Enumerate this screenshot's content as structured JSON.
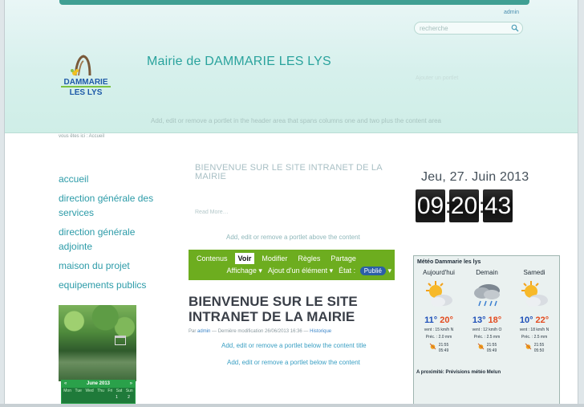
{
  "header": {
    "admin_link": "admin",
    "search_placeholder": "recherche",
    "site_title": "Mairie de DAMMARIE LES LYS",
    "faint_link": "Ajouter un portlet",
    "portlet_message": "Add, edit or remove a portlet in the header area that spans columns one and two plus the content area",
    "logo": {
      "line1": "DAMMARIE",
      "line2": "LES LYS"
    }
  },
  "breadcrumb": "vous êtes ici : Accueil",
  "nav": {
    "items": [
      "accueil",
      "direction générale des services",
      "direction générale adjointe",
      "maison du projet",
      "equipements publics"
    ]
  },
  "mini_calendar": {
    "month": "June 2013",
    "prev": "«",
    "next": "»",
    "days": [
      "Mon",
      "Tue",
      "Wed",
      "Thu",
      "Fri",
      "Sat",
      "Sun"
    ],
    "row": [
      "",
      "",
      "",
      "",
      "",
      "1",
      "2"
    ]
  },
  "content": {
    "welcome_faint": "BIENVENUE SUR LE SITE INTRANET DE LA MAIRIE",
    "read_more": "Read More…",
    "portlet_above": "Add, edit or remove a portlet above the content",
    "editbar": {
      "tabs": [
        "Contenus",
        "Voir",
        "Modifier",
        "Règles",
        "Partage"
      ],
      "active_tab": 1,
      "display_menu": "Affichage ▾",
      "add_menu": "Ajout d'un élément ▾",
      "state_label": "État :",
      "state_value": "Publié",
      "state_arrow": "▾"
    },
    "title": "BIENVENUE SUR LE SITE INTRANET DE LA MAIRIE",
    "byline": {
      "prefix": "Par",
      "author": "admin",
      "middle": "— Dernière modification 26/06/2013 16:36 —",
      "history": "Historique"
    },
    "portlet_below_title": "Add, edit or remove a portlet below the content title",
    "portlet_below_content": "Add, edit or remove a portlet below the content"
  },
  "clock": {
    "date": "Jeu, 27. Juin 2013",
    "hours": "09",
    "minutes": "20",
    "seconds": "43"
  },
  "weather": {
    "title": "Météo Dammarie les lys",
    "days": [
      {
        "label": "Aujourd'hui",
        "icon": "sun-cloud-icon",
        "lo": "11°",
        "hi": "20°",
        "wind": "vent : 15 km/h N",
        "rain": "Préc. : 2.0 mm",
        "sunset": "21:55",
        "sunrise": "05:49"
      },
      {
        "label": "Demain",
        "icon": "rain-cloud-icon",
        "lo": "13°",
        "hi": "18°",
        "wind": "vent : 12 km/h O",
        "rain": "Préc. : 2.5 mm",
        "sunset": "21:55",
        "sunrise": "05:49"
      },
      {
        "label": "Samedi",
        "icon": "sun-cloud-icon",
        "lo": "10°",
        "hi": "22°",
        "wind": "vent : 18 km/h N",
        "rain": "Préc. : 2.5 mm",
        "sunset": "21:55",
        "sunrise": "05:50"
      }
    ],
    "footer": "A proximité: Prévisions météo Melun"
  }
}
